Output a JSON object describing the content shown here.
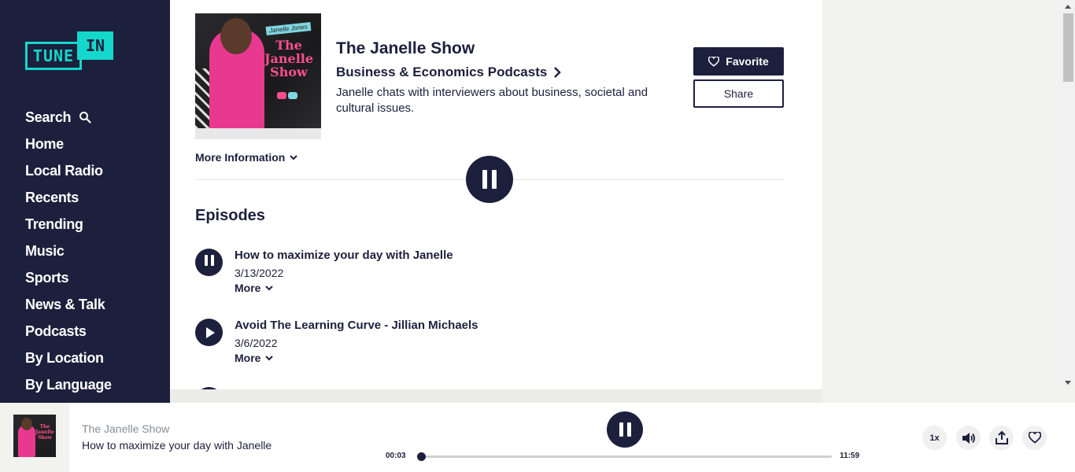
{
  "brand": {
    "tune": "TUNE",
    "in": "IN",
    "accent": "#14d8cc",
    "navy": "#1c203c"
  },
  "sidebar": {
    "items": [
      {
        "label": "Search",
        "icon": "search-icon"
      },
      {
        "label": "Home"
      },
      {
        "label": "Local Radio"
      },
      {
        "label": "Recents"
      },
      {
        "label": "Trending"
      },
      {
        "label": "Music"
      },
      {
        "label": "Sports"
      },
      {
        "label": "News & Talk"
      },
      {
        "label": "Podcasts"
      },
      {
        "label": "By Location"
      },
      {
        "label": "By Language"
      }
    ]
  },
  "show": {
    "cover_tag": "Janelle Jones",
    "cover_title": "The Janelle Show",
    "title": "The Janelle Show",
    "category": "Business & Economics Podcasts",
    "description": "Janelle chats with interviewers about business, societal and cultural issues.",
    "favorite_label": "Favorite",
    "share_label": "Share",
    "more_info_label": "More Information"
  },
  "episodes": {
    "heading": "Episodes",
    "items": [
      {
        "title": "How to maximize your day with Janelle",
        "date": "3/13/2022",
        "more": "More",
        "state": "playing"
      },
      {
        "title": "Avoid The Learning Curve - Jillian Michaels",
        "date": "3/6/2022",
        "more": "More",
        "state": "paused"
      }
    ]
  },
  "player": {
    "show": "The Janelle Show",
    "episode": "How to maximize your day with Janelle",
    "elapsed": "00:03",
    "duration": "11:59",
    "progress": 0.004,
    "speed": "1x"
  }
}
